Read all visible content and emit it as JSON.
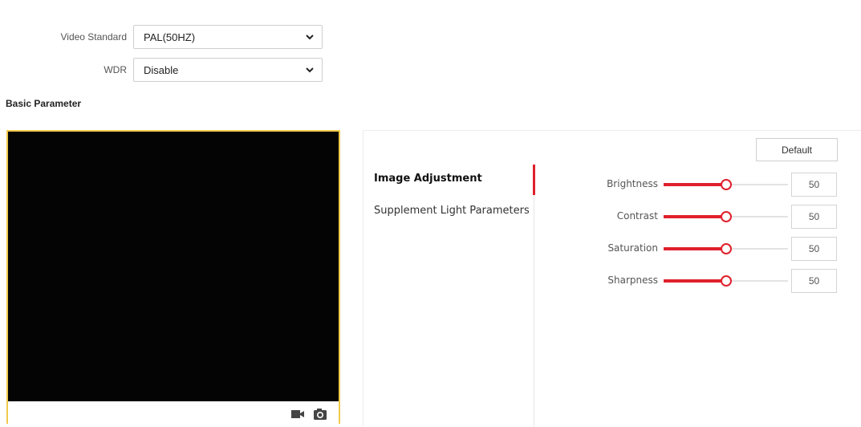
{
  "video_settings": {
    "video_standard": {
      "label": "Video Standard",
      "value": "PAL(50HZ)"
    },
    "wdr": {
      "label": "WDR",
      "value": "Disable"
    }
  },
  "section_title": "Basic Parameter",
  "video_toolbar": {
    "record_icon": "video-camera-icon",
    "capture_icon": "camera-icon"
  },
  "panel": {
    "default_button": "Default",
    "nav": [
      {
        "label": "Image Adjustment",
        "active": true
      },
      {
        "label": "Supplement Light Parameters",
        "active": false
      }
    ],
    "params": [
      {
        "label": "Brightness",
        "value": "50",
        "level": 0.5
      },
      {
        "label": "Contrast",
        "value": "50",
        "level": 0.5
      },
      {
        "label": "Saturation",
        "value": "50",
        "level": 0.5
      },
      {
        "label": "Sharpness",
        "value": "50",
        "level": 0.5
      }
    ]
  },
  "colors": {
    "accent": "#e0202c",
    "video_border": "#f2c94c",
    "video_bg": "#050404"
  }
}
